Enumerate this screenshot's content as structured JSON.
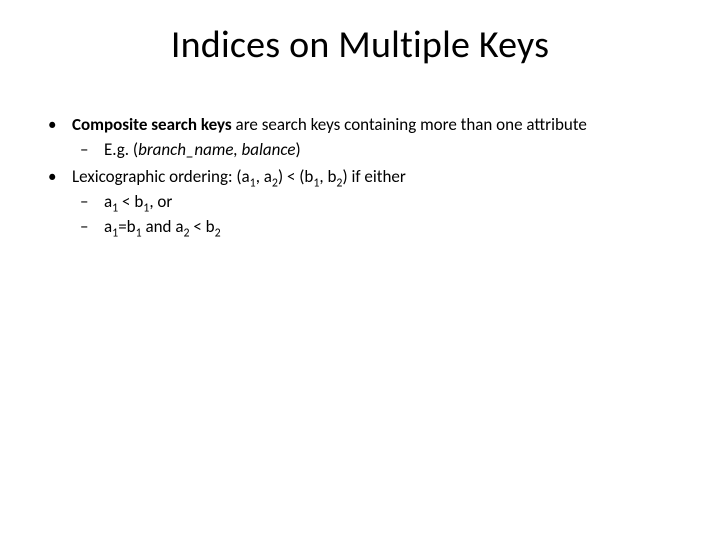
{
  "title": "Indices on Multiple Keys",
  "bullets": {
    "b1_bold": "Composite search keys",
    "b1_rest": " are search keys containing more than one attribute",
    "b1_sub_prefix": "E.g. (",
    "b1_sub_italic": "branch_name, balance",
    "b1_sub_suffix": ")",
    "b2_pre": "Lexicographic ordering: (a",
    "b2_s1": "1",
    "b2_m1": ", a",
    "b2_s2": "2",
    "b2_m2": ") < (b",
    "b2_s3": "1",
    "b2_m3": ", b",
    "b2_s4": "2",
    "b2_m4": ") if either",
    "c1_pre": " a",
    "c1_s1": "1",
    "c1_m1": " < b",
    "c1_s2": "1",
    "c1_suf": ", or",
    "c2_pre": " a",
    "c2_s1": "1",
    "c2_m1": "=b",
    "c2_s2": "1",
    "c2_m2": " and  a",
    "c2_s3": "2",
    "c2_m3": " < b",
    "c2_s4": "2"
  }
}
